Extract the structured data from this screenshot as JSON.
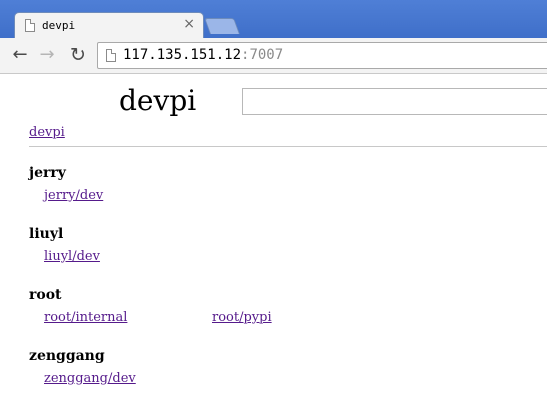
{
  "browser": {
    "tab": {
      "title": "devpi"
    },
    "address": {
      "host": "117.135.151.12",
      "port": ":7007"
    }
  },
  "page": {
    "logo": "devpi",
    "search_placeholder": "",
    "breadcrumb": "devpi",
    "users": [
      {
        "name": "jerry",
        "indexes": [
          "jerry/dev"
        ]
      },
      {
        "name": "liuyl",
        "indexes": [
          "liuyl/dev"
        ]
      },
      {
        "name": "root",
        "indexes": [
          "root/internal",
          "root/pypi"
        ]
      },
      {
        "name": "zenggang",
        "indexes": [
          "zenggang/dev"
        ]
      }
    ]
  },
  "colors": {
    "titlebar": "#4f7fd6",
    "link_visited": "#551a8b"
  }
}
